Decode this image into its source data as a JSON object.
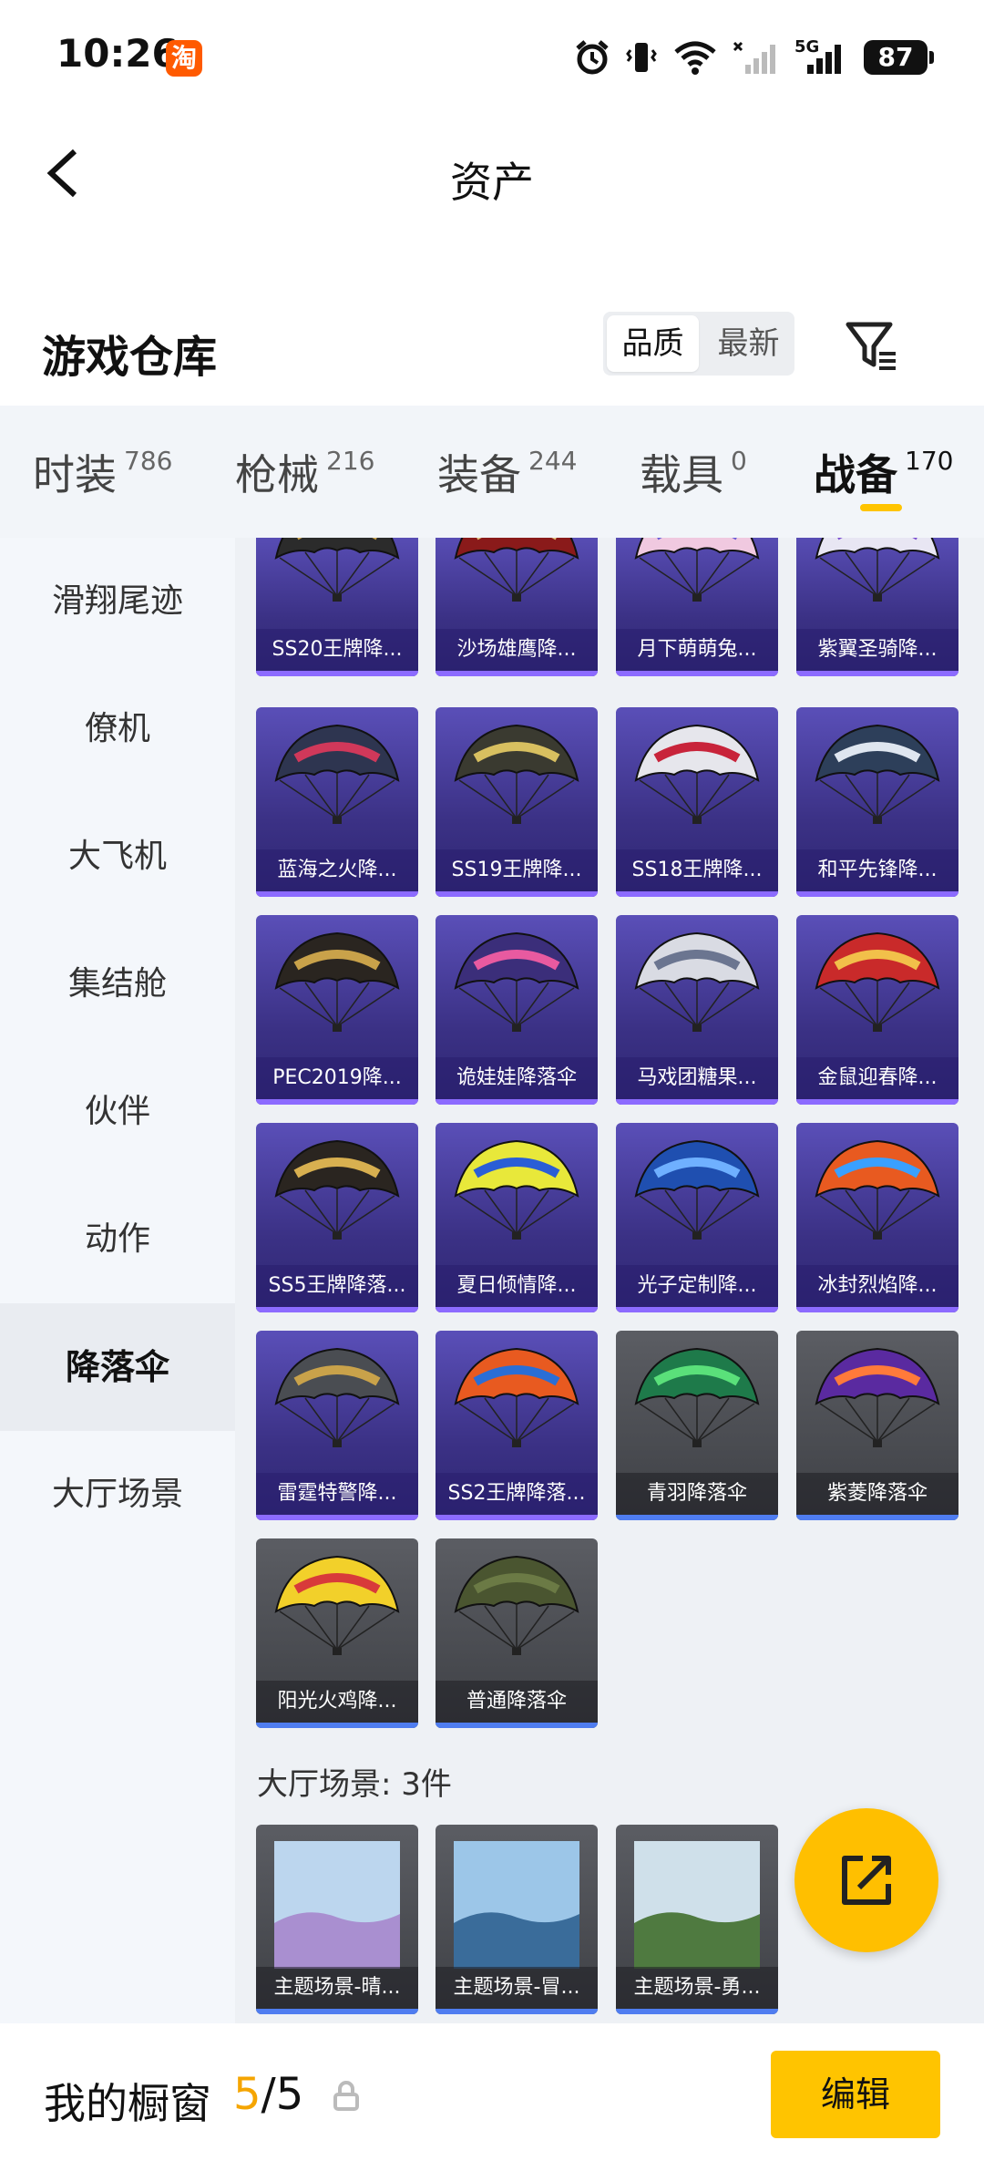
{
  "status_bar": {
    "time": "10:26",
    "taobao_badge": "淘",
    "network_label": "5G",
    "battery": "87"
  },
  "nav": {
    "title": "资产"
  },
  "warehouse": {
    "title": "游戏仓库",
    "sort_options": [
      "品质",
      "最新"
    ],
    "sort_selected": "品质"
  },
  "category_tabs": [
    {
      "label": "时装",
      "count": "786"
    },
    {
      "label": "枪械",
      "count": "216"
    },
    {
      "label": "装备",
      "count": "244"
    },
    {
      "label": "载具",
      "count": "0"
    },
    {
      "label": "战备",
      "count": "170",
      "active": true
    }
  ],
  "sidebar": {
    "items": [
      {
        "label": "滑翔尾迹"
      },
      {
        "label": "僚机"
      },
      {
        "label": "大飞机"
      },
      {
        "label": "集结舱"
      },
      {
        "label": "伙伴"
      },
      {
        "label": "动作"
      },
      {
        "label": "降落伞",
        "active": true
      },
      {
        "label": "大厅场景"
      }
    ]
  },
  "parachutes": [
    {
      "label": "SS20王牌降...",
      "style": "purple",
      "c1": "#2b2b2b",
      "c2": "#c9a24a"
    },
    {
      "label": "沙场雄鹰降...",
      "style": "purple",
      "c1": "#8a1a1a",
      "c2": "#e3c27a"
    },
    {
      "label": "月下萌萌兔...",
      "style": "purple",
      "c1": "#f0c9e0",
      "c2": "#6a5bd6"
    },
    {
      "label": "紫翼圣骑降...",
      "style": "purple",
      "c1": "#e8e6f3",
      "c2": "#7b4fd0"
    },
    {
      "label": "蓝海之火降...",
      "style": "purple",
      "c1": "#2e3550",
      "c2": "#d0385a"
    },
    {
      "label": "SS19王牌降...",
      "style": "purple",
      "c1": "#3a3a30",
      "c2": "#d8c060"
    },
    {
      "label": "SS18王牌降...",
      "style": "purple",
      "c1": "#e6e6ec",
      "c2": "#c8233a"
    },
    {
      "label": "和平先锋降...",
      "style": "purple",
      "c1": "#2d3f5a",
      "c2": "#dfe6f0"
    },
    {
      "label": "PEC2019降...",
      "style": "purple",
      "c1": "#2a2520",
      "c2": "#c9a24a"
    },
    {
      "label": "诡娃娃降落伞",
      "style": "purple",
      "c1": "#3b2e7a",
      "c2": "#e85aa0"
    },
    {
      "label": "马戏团糖果...",
      "style": "purple",
      "c1": "#d9dbe3",
      "c2": "#6b7590"
    },
    {
      "label": "金鼠迎春降...",
      "style": "purple",
      "c1": "#c92a2a",
      "c2": "#f2c04a"
    },
    {
      "label": "SS5王牌降落...",
      "style": "purple",
      "c1": "#2a2520",
      "c2": "#d8b050"
    },
    {
      "label": "夏日倾情降...",
      "style": "purple",
      "c1": "#e8e83a",
      "c2": "#2a5ed6"
    },
    {
      "label": "光子定制降...",
      "style": "purple",
      "c1": "#1f4fb0",
      "c2": "#6fb0ff"
    },
    {
      "label": "冰封烈焰降...",
      "style": "purple",
      "c1": "#e85a20",
      "c2": "#3aa0ff"
    },
    {
      "label": "雷霆特警降...",
      "style": "purple",
      "c1": "#4a4d52",
      "c2": "#c9a24a"
    },
    {
      "label": "SS2王牌降落...",
      "style": "purple",
      "c1": "#e85a20",
      "c2": "#2a6ed6"
    },
    {
      "label": "青羽降落伞",
      "style": "gray",
      "c1": "#1e7a4a",
      "c2": "#5ae07a"
    },
    {
      "label": "紫菱降落伞",
      "style": "gray",
      "c1": "#5a2aa0",
      "c2": "#ff7a3a"
    },
    {
      "label": "阳光火鸡降...",
      "style": "gray",
      "c1": "#f2d02a",
      "c2": "#d83a3a"
    },
    {
      "label": "普通降落伞",
      "style": "gray",
      "c1": "#4a5530",
      "c2": "#6b7a45"
    }
  ],
  "scene_section": {
    "title": "大厅场景: 3件",
    "items": [
      {
        "label": "主题场景-晴...",
        "sky": "#bcd6ee",
        "ground": "#a98fd0"
      },
      {
        "label": "主题场景-冒...",
        "sky": "#9cc6e8",
        "ground": "#3a6c9a"
      },
      {
        "label": "主题场景-勇...",
        "sky": "#cfe0ea",
        "ground": "#4f7a40"
      }
    ]
  },
  "bottom_bar": {
    "label": "我的橱窗",
    "count_current": "5",
    "count_sep": "/",
    "count_total": "5",
    "edit_label": "编辑"
  }
}
